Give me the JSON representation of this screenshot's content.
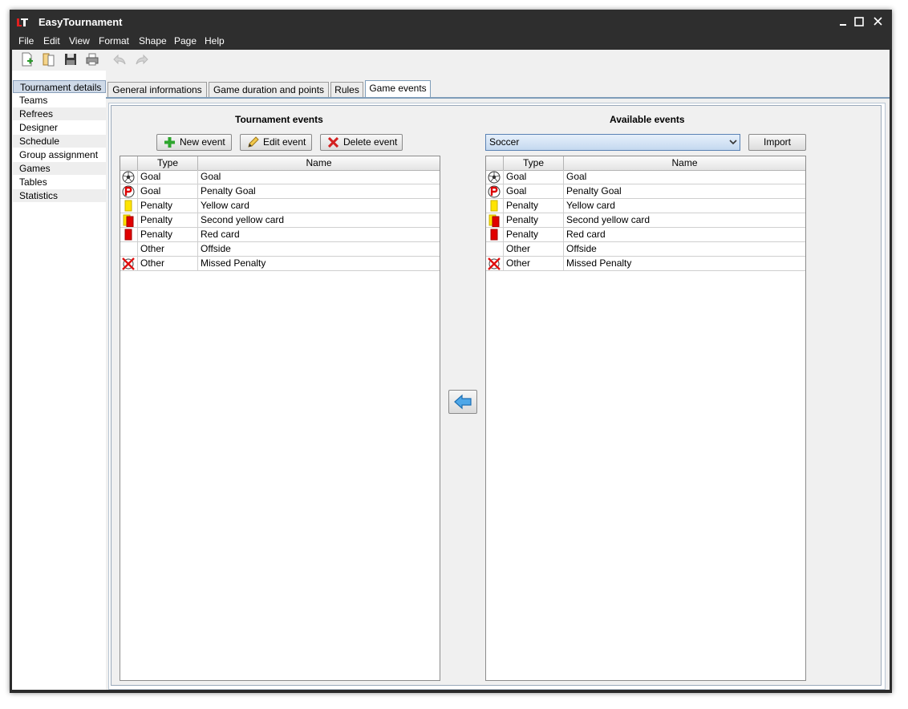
{
  "app": {
    "title": "EasyTournament"
  },
  "menu": [
    "File",
    "Edit",
    "View",
    "Format",
    "Shape",
    "Page",
    "Help"
  ],
  "toolbar": [
    "new-doc-icon",
    "open-icon",
    "save-icon",
    "print-icon",
    "undo-icon",
    "redo-icon"
  ],
  "sidebar": {
    "items": [
      "Tournament details",
      "Teams",
      "Refrees",
      "Designer",
      "Schedule",
      "Group assignment",
      "Games",
      "Tables",
      "Statistics"
    ],
    "selected": "Tournament details"
  },
  "tabs": [
    "General informations",
    "Game duration and points",
    "Rules",
    "Game events"
  ],
  "active_tab": "Game events",
  "tournament_events": {
    "title": "Tournament events",
    "buttons": {
      "new": "New event",
      "edit": "Edit event",
      "delete": "Delete event"
    },
    "columns": [
      "Type",
      "Name"
    ],
    "rows": [
      {
        "icon": "soccer-ball-icon",
        "type": "Goal",
        "name": "Goal"
      },
      {
        "icon": "penalty-goal-icon",
        "type": "Goal",
        "name": "Penalty Goal"
      },
      {
        "icon": "yellow-card-icon",
        "type": "Penalty",
        "name": "Yellow card"
      },
      {
        "icon": "second-yellow-card-icon",
        "type": "Penalty",
        "name": "Second yellow card"
      },
      {
        "icon": "red-card-icon",
        "type": "Penalty",
        "name": "Red card"
      },
      {
        "icon": "",
        "type": "Other",
        "name": "Offside"
      },
      {
        "icon": "missed-penalty-icon",
        "type": "Other",
        "name": "Missed Penalty"
      }
    ]
  },
  "available_events": {
    "title": "Available events",
    "preset": "Soccer",
    "import_label": "Import",
    "columns": [
      "Type",
      "Name"
    ],
    "rows": [
      {
        "icon": "soccer-ball-icon",
        "type": "Goal",
        "name": "Goal"
      },
      {
        "icon": "penalty-goal-icon",
        "type": "Goal",
        "name": "Penalty Goal"
      },
      {
        "icon": "yellow-card-icon",
        "type": "Penalty",
        "name": "Yellow card"
      },
      {
        "icon": "second-yellow-card-icon",
        "type": "Penalty",
        "name": "Second yellow card"
      },
      {
        "icon": "red-card-icon",
        "type": "Penalty",
        "name": "Red card"
      },
      {
        "icon": "",
        "type": "Other",
        "name": "Offside"
      },
      {
        "icon": "missed-penalty-icon",
        "type": "Other",
        "name": "Missed Penalty"
      }
    ]
  },
  "transfer_icon": "arrow-left-icon",
  "colors": {
    "titlebar": "#2e2e2e",
    "selection": "#cfdae8",
    "accent": "#7f9db9",
    "yellow_card": "#ffe400",
    "red_card": "#e10000"
  }
}
